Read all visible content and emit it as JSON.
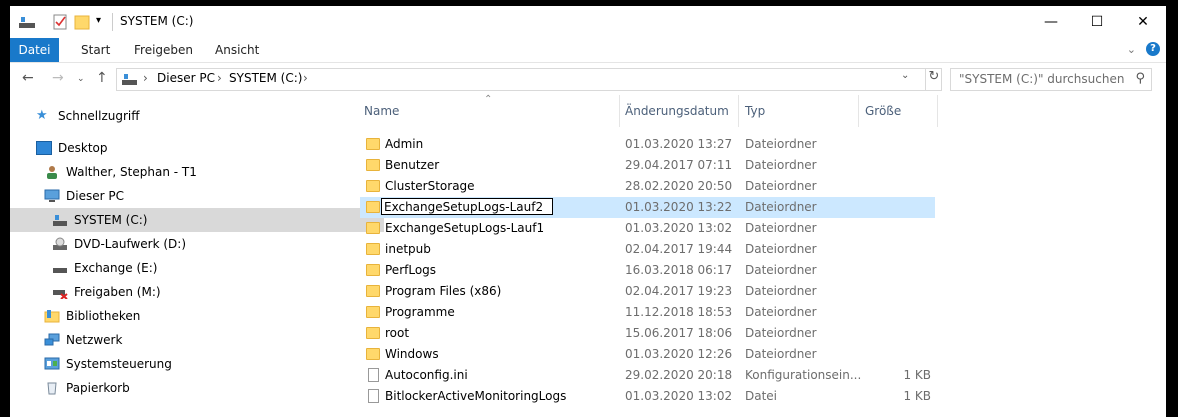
{
  "window": {
    "title": "SYSTEM (C:)",
    "controls": {
      "minimize": "—",
      "maximize": "☐",
      "close": "✕"
    }
  },
  "ribbon": {
    "tabs": [
      "Datei",
      "Start",
      "Freigeben",
      "Ansicht"
    ],
    "help_label": "?"
  },
  "address": {
    "crumbs": [
      "Dieser PC",
      "SYSTEM (C:)"
    ]
  },
  "search": {
    "placeholder": "\"SYSTEM (C:)\" durchsuchen"
  },
  "sidebar": {
    "items": [
      {
        "label": "Schnellzugriff",
        "icon": "star-icon"
      },
      {
        "label": "Desktop",
        "icon": "desktop-icon"
      },
      {
        "label": "Walther, Stephan - T1",
        "icon": "user-icon"
      },
      {
        "label": "Dieser PC",
        "icon": "computer-icon"
      },
      {
        "label": "SYSTEM (C:)",
        "icon": "drive-icon",
        "selected": true
      },
      {
        "label": "DVD-Laufwerk (D:)",
        "icon": "dvd-icon"
      },
      {
        "label": "Exchange (E:)",
        "icon": "drive-icon"
      },
      {
        "label": "Freigaben (M:)",
        "icon": "network-drive-icon"
      },
      {
        "label": "Bibliotheken",
        "icon": "library-icon"
      },
      {
        "label": "Netzwerk",
        "icon": "network-icon"
      },
      {
        "label": "Systemsteuerung",
        "icon": "control-panel-icon"
      },
      {
        "label": "Papierkorb",
        "icon": "recycle-bin-icon"
      }
    ]
  },
  "columns": {
    "name": "Name",
    "date": "Änderungsdatum",
    "type": "Typ",
    "size": "Größe"
  },
  "files": [
    {
      "name": "Admin",
      "date": "01.03.2020 13:27",
      "type": "Dateiordner",
      "size": "",
      "kind": "folder"
    },
    {
      "name": "Benutzer",
      "date": "29.04.2017 07:11",
      "type": "Dateiordner",
      "size": "",
      "kind": "folder"
    },
    {
      "name": "ClusterStorage",
      "date": "28.02.2020 20:50",
      "type": "Dateiordner",
      "size": "",
      "kind": "folder"
    },
    {
      "name": "ExchangeSetupLogs-Lauf2",
      "date": "01.03.2020 13:22",
      "type": "Dateiordner",
      "size": "",
      "kind": "folder",
      "renaming": true
    },
    {
      "name": "ExchangeSetupLogs-Lauf1",
      "date": "01.03.2020 13:02",
      "type": "Dateiordner",
      "size": "",
      "kind": "folder"
    },
    {
      "name": "inetpub",
      "date": "02.04.2017 19:44",
      "type": "Dateiordner",
      "size": "",
      "kind": "folder"
    },
    {
      "name": "PerfLogs",
      "date": "16.03.2018 06:17",
      "type": "Dateiordner",
      "size": "",
      "kind": "folder"
    },
    {
      "name": "Program Files (x86)",
      "date": "02.04.2017 19:23",
      "type": "Dateiordner",
      "size": "",
      "kind": "folder"
    },
    {
      "name": "Programme",
      "date": "11.12.2018 18:53",
      "type": "Dateiordner",
      "size": "",
      "kind": "folder"
    },
    {
      "name": "root",
      "date": "15.06.2017 18:06",
      "type": "Dateiordner",
      "size": "",
      "kind": "folder"
    },
    {
      "name": "Windows",
      "date": "01.03.2020 12:26",
      "type": "Dateiordner",
      "size": "",
      "kind": "folder"
    },
    {
      "name": "Autoconfig.ini",
      "date": "29.02.2020 20:18",
      "type": "Konfigurationsein...",
      "size": "1 KB",
      "kind": "file"
    },
    {
      "name": "BitlockerActiveMonitoringLogs",
      "date": "01.03.2020 13:02",
      "type": "Datei",
      "size": "1 KB",
      "kind": "file"
    }
  ]
}
